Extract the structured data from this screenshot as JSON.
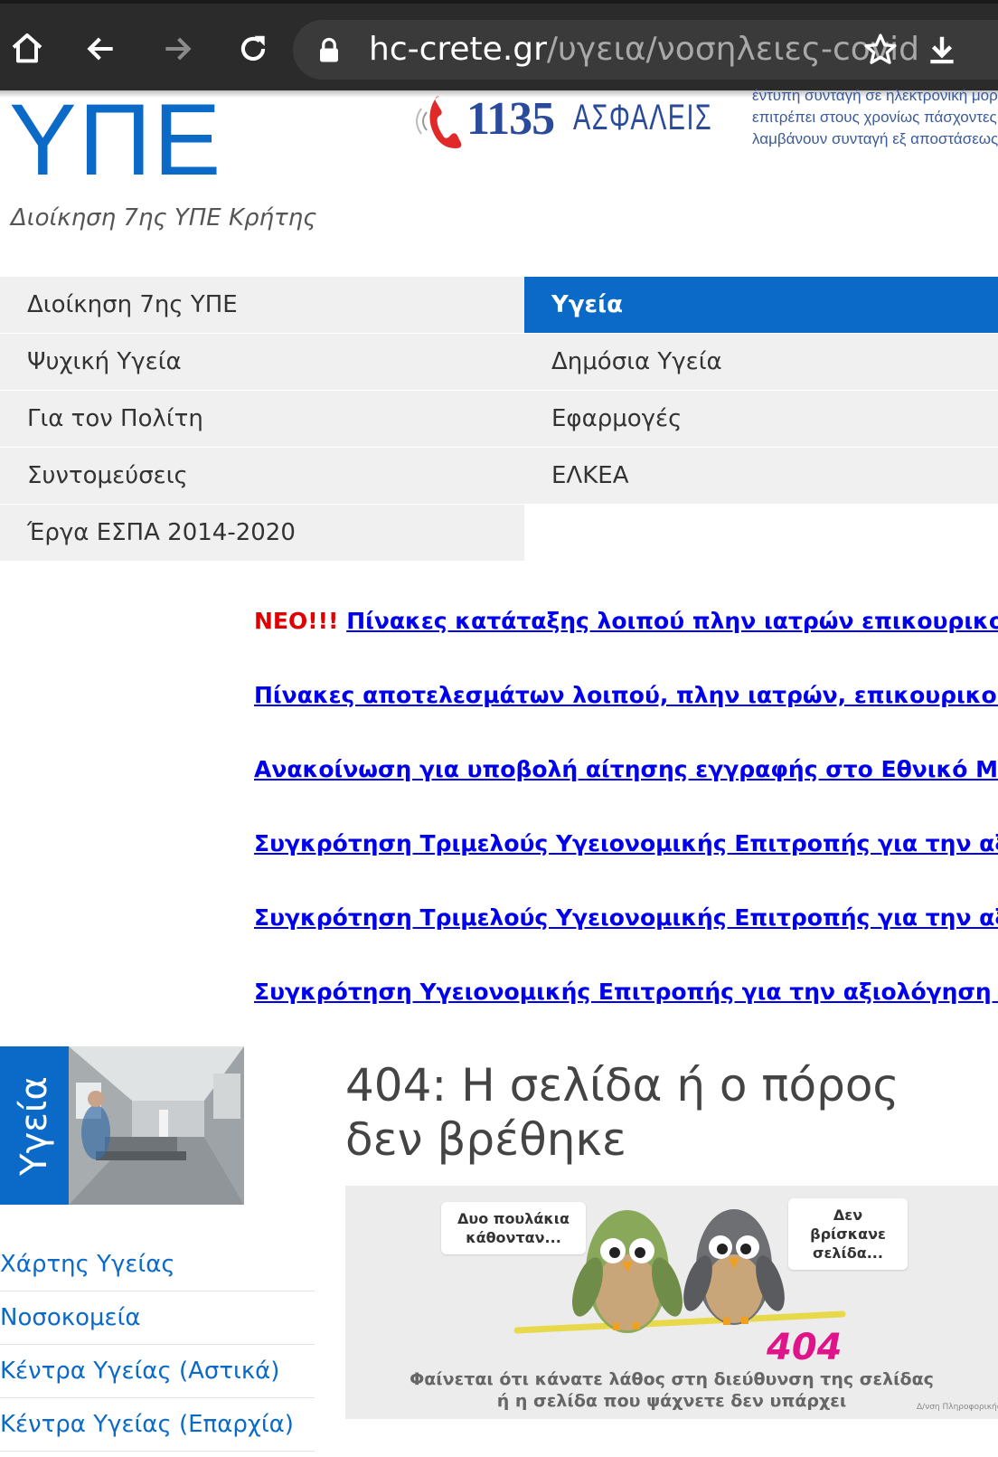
{
  "browser": {
    "url_host": "hc-crete.gr",
    "url_path": "/υγεια/νοσηλειες-covid",
    "icons": [
      "home-icon",
      "back-icon",
      "forward-icon",
      "reload-icon",
      "lock-icon",
      "star-icon",
      "download-icon"
    ]
  },
  "header": {
    "logo": "ΥΠΕ",
    "subtitle": "Διοίκηση 7ης ΥΠΕ Κρήτης",
    "hotline_number": "1135",
    "hotline_word": "ΑΣΦΑΛΕΙΣ",
    "eprescription_lines": [
      "έντυπη συνταγή σε ηλεκτρονική μορφή",
      "επιτρέπει στους χρονίως πάσχοντες να",
      "λαμβάνουν συνταγή εξ αποστάσεως."
    ]
  },
  "nav": {
    "rows": [
      {
        "left": "Διοίκηση 7ης ΥΠΕ",
        "right": "Υγεία"
      },
      {
        "left": "Ψυχική Υγεία",
        "right": "Δημόσια Υγεία"
      },
      {
        "left": "Για τον Πολίτη",
        "right": "Εφαρμογές"
      },
      {
        "left": "Συντομεύσεις",
        "right": "ΕΛΚΕΑ"
      },
      {
        "left": "Έργα ΕΣΠΑ 2014-2020",
        "right": ""
      }
    ],
    "active": "Υγεία"
  },
  "news": {
    "new_badge": "ΝΕΟ!!!",
    "items": [
      "Πίνακες κατάταξης λοιπού πλην ιατρών επικουρικού προ",
      "Πίνακες αποτελεσμάτων λοιπού, πλην ιατρών, επικουρικού προ",
      "Ανακοίνωση για υποβολή αίτησης εγγραφής στο Εθνικό Μητρώο",
      "Συγκρότηση Τριμελούς Υγειονομικής Επιτροπής για την αξιολόγ",
      "Συγκρότηση Τριμελούς Υγειονομικής Επιτροπής για την αξιολόγ",
      "Συγκρότηση Υγειονομικής Επιτροπής για την αξιολόγηση των αι"
    ]
  },
  "sidebar": {
    "banner_label": "Υγεία",
    "links": [
      "Χάρτης Υγείας",
      "Νοσοκομεία",
      "Κέντρα Υγείας (Αστικά)",
      "Κέντρα Υγείας (Επαρχία)"
    ]
  },
  "error": {
    "title": "404: Η σελίδα ή ο πόρος δεν βρέθηκε",
    "bubble_left": "Δυο πουλάκια κάθονταν...",
    "bubble_right": "Δεν βρίσκανε σελίδα...",
    "code": "404",
    "message_line1": "Φαίνεται ότι κάνατε λάθος στη διεύθυνση της σελίδας",
    "message_line2": "ή η σελίδα που ψάχνετε δεν υπάρχει",
    "credit": "Δ/νση Πληροφορικής"
  },
  "colors": {
    "brand_blue": "#0b6ac8",
    "link_blue": "#0000ee",
    "alert_red": "#e00000",
    "magenta_404": "#e0148a"
  }
}
